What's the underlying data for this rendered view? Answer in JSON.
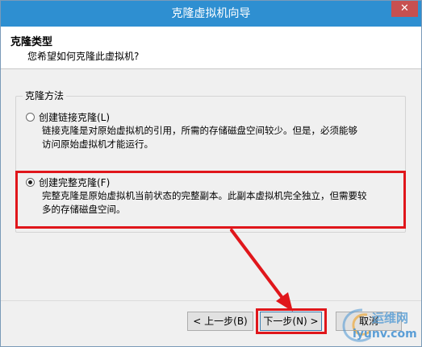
{
  "window": {
    "title": "克隆虚拟机向导",
    "close_glyph": "✕"
  },
  "header": {
    "title": "克隆类型",
    "subtitle": "您希望如何克隆此虚拟机?"
  },
  "clone_method": {
    "group_label": "克隆方法",
    "options": [
      {
        "label": "创建链接克隆(L)",
        "selected": false,
        "description_lines": [
          "链接克隆是对原始虚拟机的引用，所需的存储磁盘空间较少。但是，必须能够",
          "访问原始虚拟机才能运行。"
        ]
      },
      {
        "label": "创建完整克隆(F)",
        "selected": true,
        "description_lines": [
          "完整克隆是原始虚拟机当前状态的完整副本。此副本虚拟机完全独立，但需要较",
          "多的存储磁盘空间。"
        ]
      }
    ]
  },
  "footer": {
    "back_label": "< 上一步(B)",
    "next_label": "下一步(N) >",
    "cancel_label": "取消"
  },
  "watermark": {
    "line1": "运维网",
    "line2": "iyunv.com"
  },
  "colors": {
    "titlebar": "#2e8fd1",
    "annotation_red": "#e0161b",
    "close_button": "#c75050"
  }
}
